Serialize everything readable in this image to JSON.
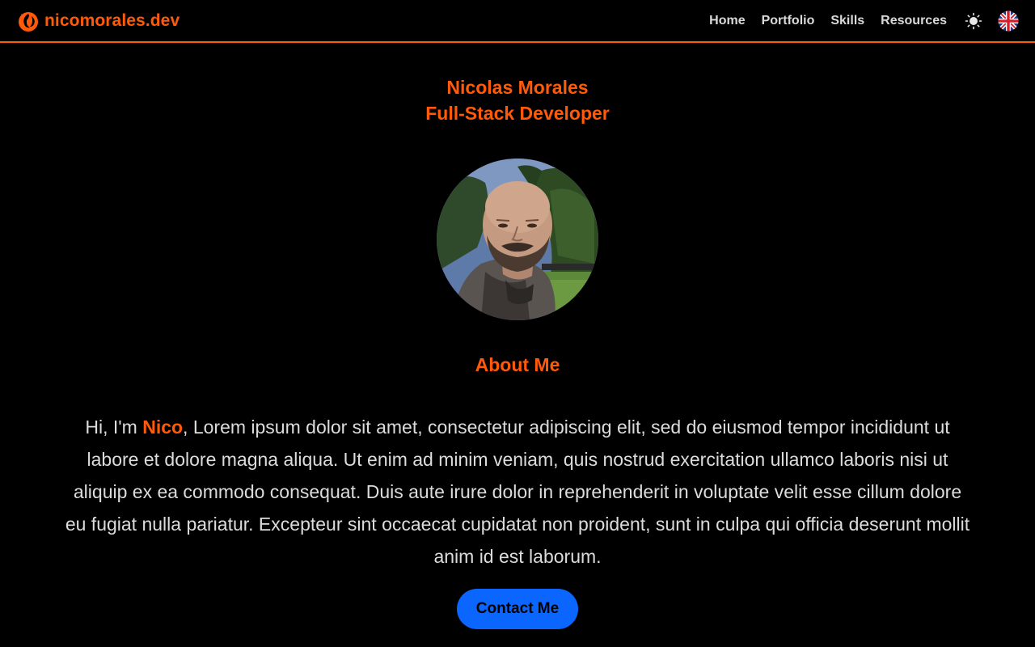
{
  "brand": {
    "name": "nicomorales.dev",
    "logo_icon": "phoenix-logo-icon"
  },
  "nav": {
    "items": [
      {
        "label": "Home"
      },
      {
        "label": "Portfolio"
      },
      {
        "label": "Skills"
      },
      {
        "label": "Resources"
      }
    ],
    "theme_toggle_icon": "sun-icon",
    "language_icon": "uk-flag-icon"
  },
  "hero": {
    "name": "Nicolas Morales",
    "role": "Full-Stack Developer",
    "avatar_icon": "profile-photo"
  },
  "about": {
    "heading": "About Me",
    "intro_prefix": "Hi, I'm ",
    "intro_name": "Nico",
    "body": ", Lorem ipsum dolor sit amet, consectetur adipiscing elit, sed do eiusmod tempor incididunt ut labore et dolore magna aliqua. Ut enim ad minim veniam, quis nostrud exercitation ullamco laboris nisi ut aliquip ex ea commodo consequat. Duis aute irure dolor in reprehenderit in voluptate velit esse cillum dolore eu fugiat nulla pariatur. Excepteur sint occaecat cupidatat non proident, sunt in culpa qui officia deserunt mollit anim id est laborum.",
    "contact_label": "Contact Me"
  },
  "colors": {
    "accent": "#ff5a0a",
    "background": "#000000",
    "button": "#0a66ff",
    "text": "#dcdcdc"
  }
}
